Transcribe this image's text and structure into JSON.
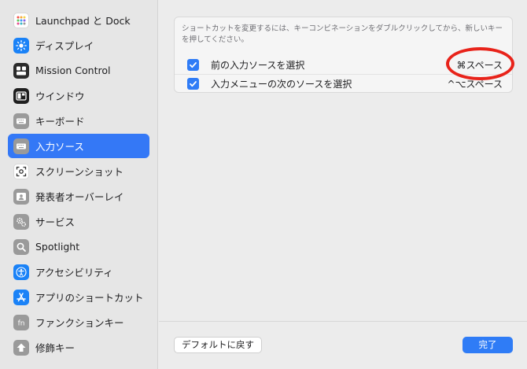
{
  "sidebar": {
    "items": [
      {
        "label": "Launchpad と Dock",
        "icon": "launchpad-icon",
        "color": "#ffffff"
      },
      {
        "label": "ディスプレイ",
        "icon": "display-icon",
        "color": "#1a82f7"
      },
      {
        "label": "Mission Control",
        "icon": "mission-control-icon",
        "color": "#2b2b2b"
      },
      {
        "label": "ウインドウ",
        "icon": "window-icon",
        "color": "#1f1f1f"
      },
      {
        "label": "キーボード",
        "icon": "keyboard-icon",
        "color": "#9a9a9a"
      },
      {
        "label": "入力ソース",
        "icon": "input-source-icon",
        "color": "#9a9a9a"
      },
      {
        "label": "スクリーンショット",
        "icon": "screenshot-icon",
        "color": "#ffffff"
      },
      {
        "label": "発表者オーバーレイ",
        "icon": "presenter-overlay-icon",
        "color": "#9a9a9a"
      },
      {
        "label": "サービス",
        "icon": "services-icon",
        "color": "#9a9a9a"
      },
      {
        "label": "Spotlight",
        "icon": "spotlight-icon",
        "color": "#9a9a9a"
      },
      {
        "label": "アクセシビリティ",
        "icon": "accessibility-icon",
        "color": "#1a82f7"
      },
      {
        "label": "アプリのショートカット",
        "icon": "app-store-icon",
        "color": "#1a82f7"
      },
      {
        "label": "ファンクションキー",
        "icon": "fn-key-icon",
        "color": "#9a9a9a"
      },
      {
        "label": "修飾キー",
        "icon": "modifier-key-icon",
        "color": "#9a9a9a"
      }
    ],
    "selected_index": 5
  },
  "panel": {
    "hint": "ショートカットを変更するには、キーコンビネーションをダブルクリックしてから、新しいキーを押してください。",
    "rows": [
      {
        "label": "前の入力ソースを選択",
        "shortcut": "⌘スペース",
        "checked": true
      },
      {
        "label": "入力メニューの次のソースを選択",
        "shortcut": "^⌥スペース",
        "checked": true
      }
    ]
  },
  "footer": {
    "default_label": "デフォルトに戻す",
    "done_label": "完了"
  },
  "colors": {
    "accent": "#2f7cf6",
    "highlight_oval": "#e8231a"
  }
}
